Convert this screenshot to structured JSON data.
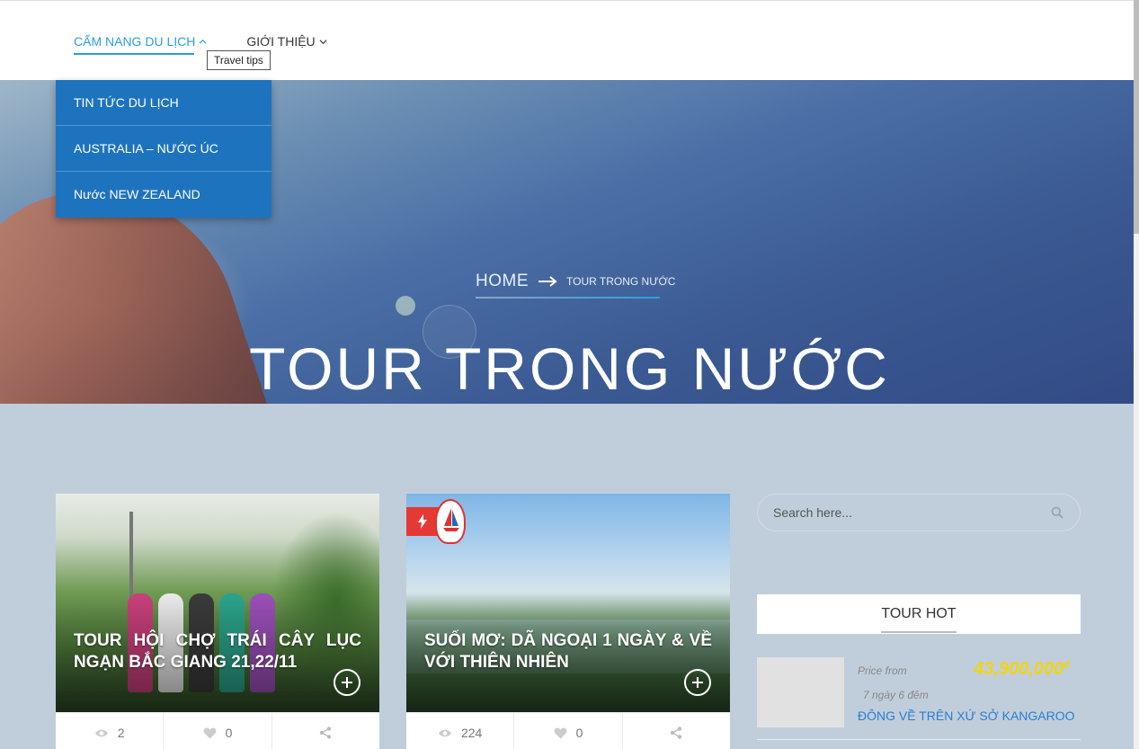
{
  "nav": {
    "items": [
      {
        "label": "CẨM NANG DU LỊCH",
        "active": true
      },
      {
        "label": "GIỚI THIỆU",
        "active": false
      }
    ],
    "tooltip": "Travel tips",
    "dropdown": [
      "TIN TỨC DU LỊCH",
      "AUSTRALIA – NƯỚC ÚC",
      "Nước NEW ZEALAND"
    ]
  },
  "hero": {
    "breadcrumb_home": "HOME",
    "breadcrumb_current": "TOUR TRONG NƯỚC",
    "title": "TOUR TRONG NƯỚC"
  },
  "cards": [
    {
      "title": "TOUR HỘI CHỢ TRÁI CÂY LỤC NGẠN BẮC GIANG 21,22/11",
      "views": "2",
      "likes": "0"
    },
    {
      "title": "SUỐI MƠ: DÃ NGOẠI 1 NGÀY & VỀ VỚI THIÊN NHIÊN",
      "views": "224",
      "likes": "0"
    }
  ],
  "sidebar": {
    "search_placeholder": "Search here...",
    "tour_hot_title": "TOUR HOT",
    "hot_item": {
      "price_label": "Price from",
      "price": "43,900,000",
      "currency": "đ",
      "duration": "7 ngày 6 đêm",
      "name": "ĐÔNG VỀ TRÊN XỨ SỞ KANGAROO"
    }
  },
  "colors": {
    "accent": "#2a9ee0",
    "dropdown_bg": "#1e73be",
    "page_bg": "#c0cedb",
    "price": "#f2d416",
    "hot_badge": "#e53935"
  }
}
